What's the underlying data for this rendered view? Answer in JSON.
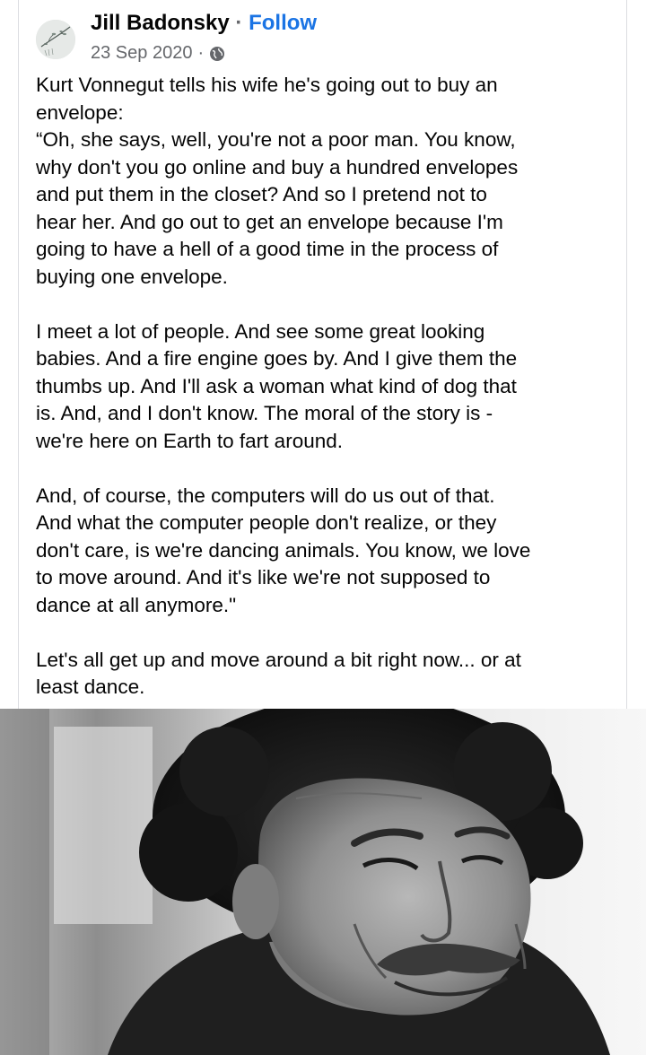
{
  "post": {
    "author_name": "Jill Badonsky",
    "separator": "·",
    "follow_label": "Follow",
    "date": "23 Sep 2020",
    "meta_separator": "·",
    "privacy_icon": "globe-icon",
    "paragraph_1": [
      "Kurt Vonnegut tells his wife he's going out to buy an",
      "envelope:",
      "“Oh, she says, well, you're not a poor man. You know,",
      "why don't you go online and buy a hundred envelopes",
      "and put them in the closet? And so I pretend not to",
      "hear her. And go out to get an envelope because I'm",
      "going to have a hell of a good time in the process of",
      "buying one envelope."
    ],
    "paragraph_2": [
      "I meet a lot of people. And see some great looking",
      "babies. And a fire engine goes by. And I give them the",
      "thumbs up. And I'll ask a woman what kind of dog that",
      "is. And, and I don't know. The moral of the story is -",
      "we're here on Earth to fart around."
    ],
    "paragraph_3": [
      "And, of course, the computers will do us out of that.",
      "And what the computer people don't realize, or they",
      "don't care, is we're dancing animals. You know, we love",
      "to move around. And it's like we're not supposed to",
      "dance at all anymore.\""
    ],
    "paragraph_4": [
      "Let's all get up and move around a bit right now... or at",
      "least dance."
    ]
  },
  "colors": {
    "text": "#050505",
    "secondary_text": "#65676b",
    "link": "#1b74e4",
    "divider": "#dcdde1"
  }
}
